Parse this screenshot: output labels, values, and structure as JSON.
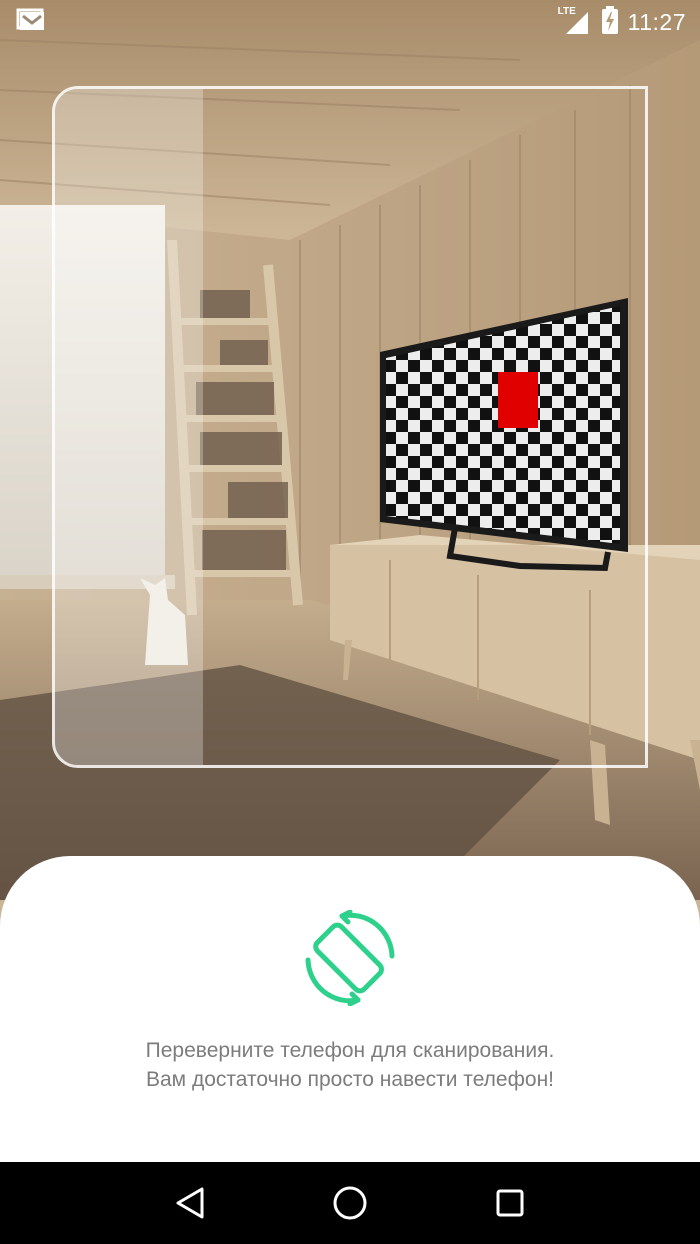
{
  "status_bar": {
    "notification_icon": "gmail-icon",
    "network_label": "LTE",
    "battery_icon": "battery-charging-icon",
    "time": "11:27"
  },
  "scene": {
    "description_icon": "room-with-tv-image",
    "tv_screen_pattern": "checkerboard",
    "target_color": "#e00000"
  },
  "hint": {
    "icon": "screen-rotation-icon",
    "icon_color": "#2ed18c",
    "line1": "Переверните телефон для сканирования.",
    "line2": "Вам достаточно просто навести телефон!"
  },
  "nav_bar": {
    "back_icon": "back-triangle-icon",
    "home_icon": "home-circle-icon",
    "recents_icon": "recents-square-icon"
  }
}
